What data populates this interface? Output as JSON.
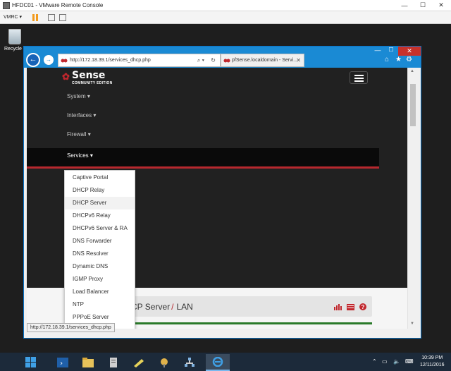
{
  "vmrc": {
    "title": "HFDC01 - VMware Remote Console",
    "menu_label": "VMRC ▾",
    "min": "—",
    "max": "☐",
    "close": "✕"
  },
  "desktop": {
    "recycle_label": "Recycle B"
  },
  "browser": {
    "address": "http://172.18.39.1/services_dhcp.php",
    "tab_title": "pfSense.localdomain - Servi...",
    "tab_close": "✕",
    "back": "←",
    "forward": "→",
    "search_glyph": "⌕ ▾",
    "refresh_glyph": "↻",
    "home_icon": "⌂",
    "favorites_icon": "★",
    "settings_icon": "⚙",
    "min": "—",
    "max": "☐",
    "close": "✕",
    "status_url": "http://172.18.39.1/services_dhcp.php"
  },
  "pfsense": {
    "logo_main": "Sense",
    "logo_sub": "COMMUNITY EDITION",
    "nav": [
      {
        "label": "System ▾"
      },
      {
        "label": "Interfaces ▾"
      },
      {
        "label": "Firewall ▾"
      },
      {
        "label": "Services ▾"
      }
    ],
    "services_menu": [
      "Captive Portal",
      "DHCP Relay",
      "DHCP Server",
      "DHCPv6 Relay",
      "DHCPv6 Server & RA",
      "DNS Forwarder",
      "DNS Resolver",
      "Dynamic DNS",
      "IGMP Proxy",
      "Load Balancer",
      "NTP",
      "PPPoE Server"
    ],
    "breadcrumb_part1": "CP Server",
    "breadcrumb_sep": "/",
    "breadcrumb_part2": "LAN"
  },
  "taskbar": {
    "time": "10:39 PM",
    "date": "12/11/2016"
  }
}
